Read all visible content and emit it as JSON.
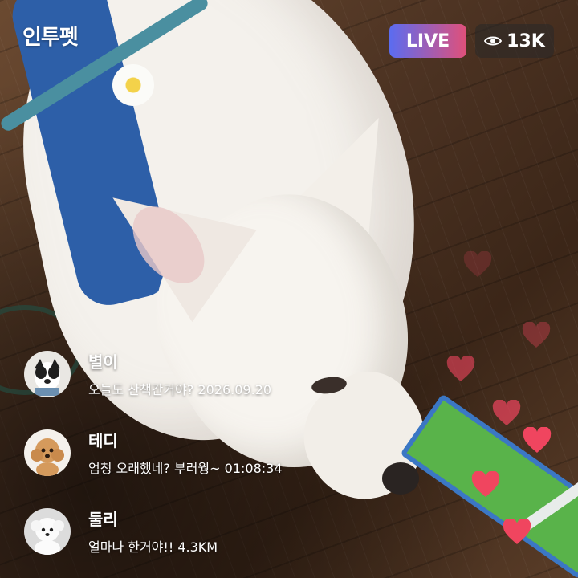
{
  "app": {
    "logo": "인투펫"
  },
  "header": {
    "live_label": "LIVE",
    "viewer_count": "13K",
    "viewer_icon": "eye-icon"
  },
  "comments": [
    {
      "name": "별이",
      "message": "오늘도 산책간거야? 2026.09.20",
      "avatar": "dog-avatar-border-collie"
    },
    {
      "name": "테디",
      "message": "엄청 오래했네? 부러웡~ 01:08:34",
      "avatar": "dog-avatar-poodle"
    },
    {
      "name": "둘리",
      "message": "얼마나 한거야!! 4.3KM",
      "avatar": "dog-avatar-white-fluffy"
    }
  ],
  "reactions": {
    "icon": "heart-icon",
    "color": "#f0455f"
  },
  "colors": {
    "live_start": "#5b6cf0",
    "live_end": "#e0507a",
    "heart": "#f0455f"
  }
}
